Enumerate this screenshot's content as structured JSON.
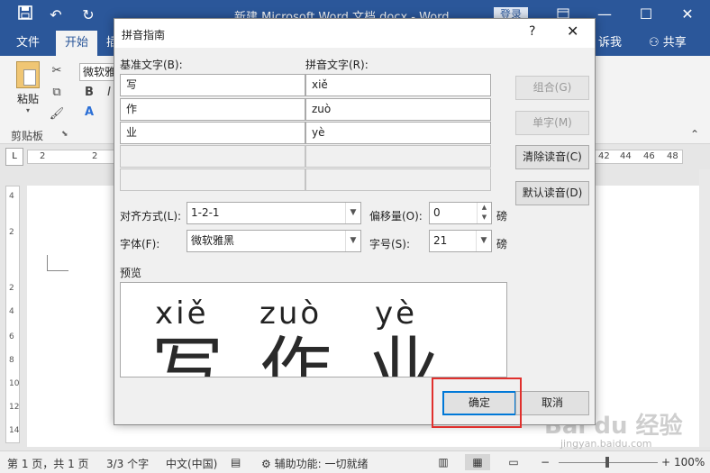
{
  "window": {
    "title": "新建 Microsoft Word 文档.docx - Word",
    "login": "登录",
    "icons": [
      "save-icon",
      "undo-icon",
      "redo-icon",
      "ribbon-display-icon",
      "minimize-icon",
      "maximize-icon",
      "close-icon"
    ]
  },
  "ribbon": {
    "tabs": [
      "文件",
      "开始",
      "插"
    ],
    "tell_me": "诉我",
    "share": "共享",
    "paste_label": "粘贴",
    "font_name": "微软雅黑",
    "clipboard_group": "剪贴板",
    "bold": "B",
    "italic": "I",
    "font_color": "A"
  },
  "ruler": {
    "numbers_left": [
      "2",
      "2"
    ],
    "numbers_right": [
      "42",
      "44",
      "46",
      "48"
    ],
    "vertical_numbers": [
      "4",
      "2",
      "2",
      "4",
      "6",
      "8",
      "10",
      "12",
      "14"
    ]
  },
  "dialog": {
    "title": "拼音指南",
    "help": "?",
    "base_label": "基准文字(B):",
    "ruby_label": "拼音文字(R):",
    "rows": [
      {
        "base": "写",
        "ruby": "xiě"
      },
      {
        "base": "作",
        "ruby": "zuò"
      },
      {
        "base": "业",
        "ruby": "yè"
      },
      {
        "base": "",
        "ruby": ""
      },
      {
        "base": "",
        "ruby": ""
      }
    ],
    "buttons": {
      "group": "组合(G)",
      "mono": "单字(M)",
      "clear": "清除读音(C)",
      "default": "默认读音(D)"
    },
    "alignment_label": "对齐方式(L):",
    "alignment_value": "1-2-1",
    "offset_label": "偏移量(O):",
    "offset_value": "0",
    "offset_unit": "磅",
    "font_label": "字体(F):",
    "font_value": "微软雅黑",
    "size_label": "字号(S):",
    "size_value": "21",
    "size_unit": "磅",
    "preview_label": "预览",
    "preview_pinyin": [
      "xiě",
      "zuò",
      "yè"
    ],
    "preview_chars": [
      "写",
      "作",
      "业"
    ],
    "ok": "确定",
    "cancel": "取消"
  },
  "status": {
    "page": "第 1 页，共 1 页",
    "words": "3/3 个字",
    "language": "中文(中国)",
    "accessibility": "辅助功能: 一切就绪",
    "zoom": "100%"
  },
  "watermark": {
    "logo": "Bai du 经验",
    "url": "jingyan.baidu.com"
  }
}
